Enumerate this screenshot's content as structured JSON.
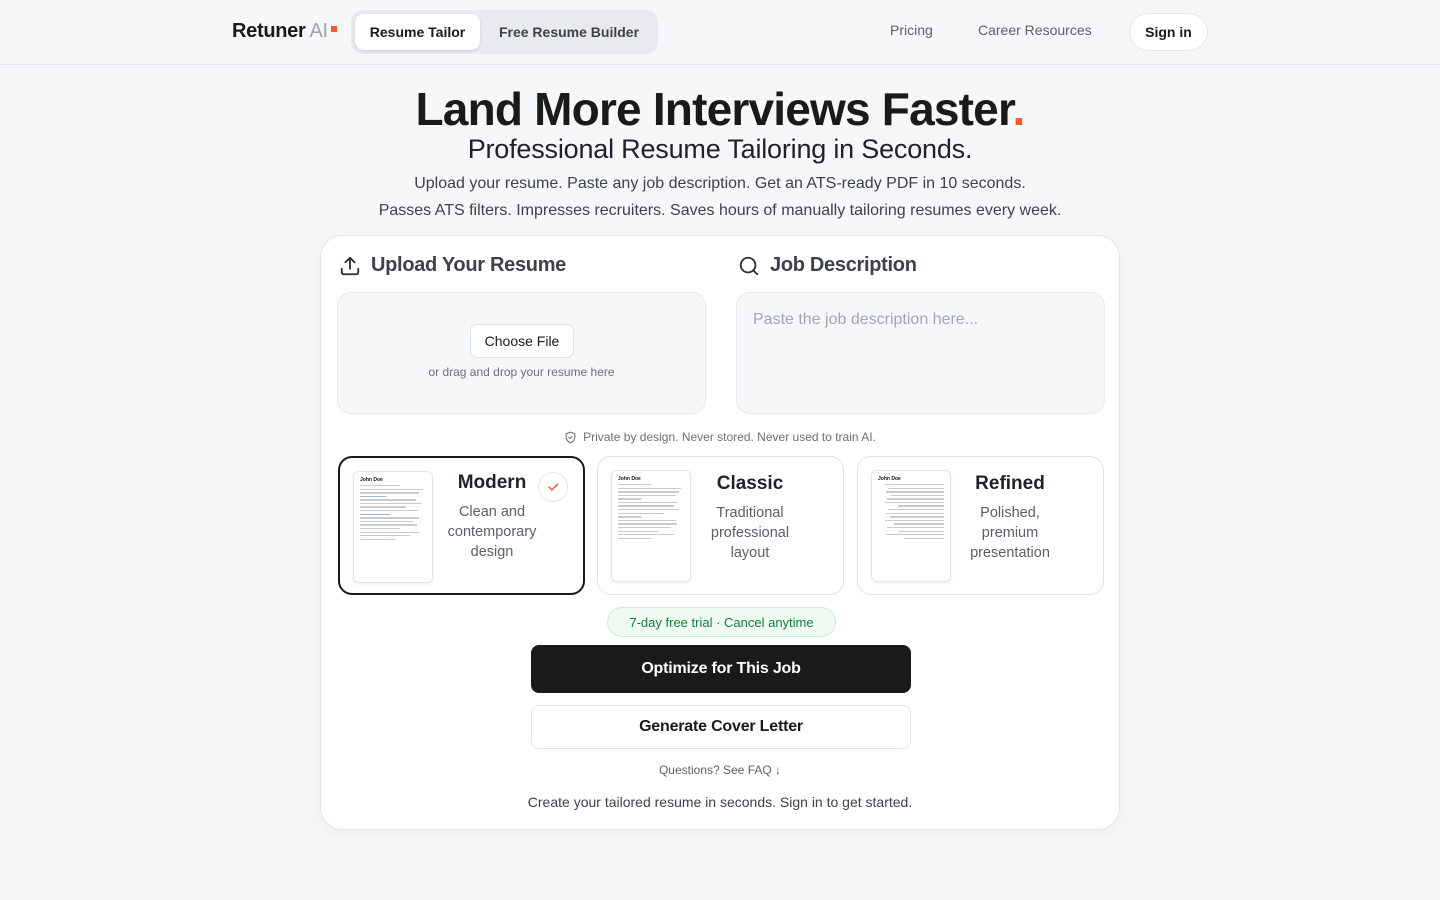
{
  "nav": {
    "logo_text": "Retuner",
    "logo_ai": "AI",
    "tabs": [
      {
        "label": "Resume Tailor",
        "active": true
      },
      {
        "label": "Free Resume Builder",
        "active": false
      }
    ],
    "links": [
      "Pricing",
      "Career Resources"
    ],
    "signin_label": "Sign in",
    "accent_color": "#f05a28"
  },
  "hero": {
    "title": "Land More Interviews Faster",
    "title_dot": ".",
    "subtitle": "Professional Resume Tailoring in Seconds.",
    "line1": "Upload your resume. Paste any job description. Get an ATS-ready PDF in 10 seconds.",
    "line2": "Passes ATS filters. Impresses recruiters. Saves hours of manually tailoring resumes every week."
  },
  "upload": {
    "heading": "Upload Your Resume",
    "icon": "upload-icon",
    "choose_label": "Choose File",
    "hint": "or drag and drop your resume here"
  },
  "job": {
    "heading": "Job Description",
    "icon": "search-icon",
    "placeholder": "Paste the job description here..."
  },
  "privacy": "Private by design. Never stored. Never used to train AI.",
  "templates": [
    {
      "name": "Modern",
      "description": "Clean and contemporary design",
      "selected": true,
      "thumb_name": "John Doe"
    },
    {
      "name": "Classic",
      "description": "Traditional professional layout",
      "selected": false,
      "thumb_name": "John Doe"
    },
    {
      "name": "Refined",
      "description": "Polished, premium presentation",
      "selected": false,
      "thumb_name": "John Doe"
    }
  ],
  "trial_badge": "7-day free trial · Cancel anytime",
  "primary_cta": "Optimize for This Job",
  "secondary_cta": "Generate Cover Letter",
  "faq_link": "Questions? See FAQ ↓",
  "footer_note": "Create your tailored resume in seconds. Sign in to get started."
}
